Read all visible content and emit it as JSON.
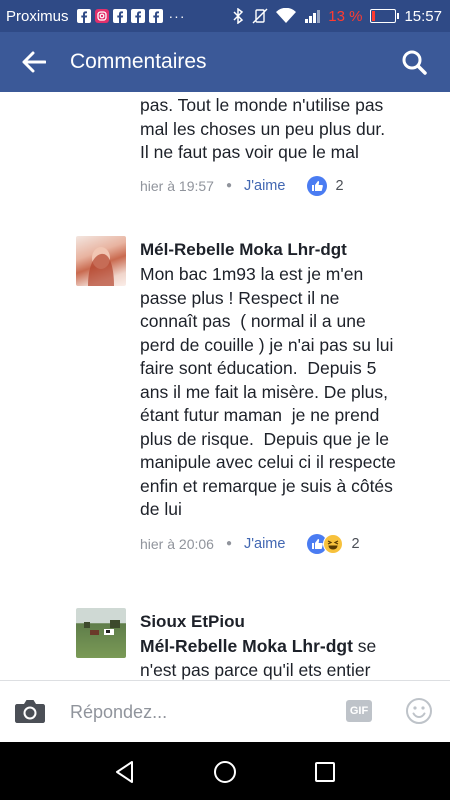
{
  "statusbar": {
    "carrier": "Proximus",
    "battery_percent": "13 %",
    "battery_level": 0.13,
    "time": "15:57",
    "notification_icons": [
      "facebook-icon",
      "instagram-icon",
      "facebook-icon",
      "facebook-icon",
      "facebook-icon"
    ]
  },
  "appbar": {
    "title": "Commentaires",
    "color": "#3b5998"
  },
  "comments": [
    {
      "text_lines": [
        "pas. Tout le monde n'utilise pas",
        "mal les choses un peu plus dur.",
        "Il ne faut pas voir que le mal"
      ],
      "time": "hier à 19:57",
      "like_label": "J'aime",
      "reaction_count": "2",
      "reactions": [
        "like"
      ]
    },
    {
      "author": "Mél-Rebelle Moka Lhr-dgt",
      "text_lines": [
        "Mon bac 1m93 la est je m'en",
        "passe plus ! Respect il ne",
        "connaît pas  ( normal il a une",
        "perd de couille ) je n'ai pas su lui",
        "faire sont éducation.  Depuis 5",
        "ans il me fait la misère. De plus,",
        "étant futur maman  je ne prend",
        "plus de risque.  Depuis que je le",
        "manipule avec celui ci il respecte",
        "enfin et remarque je suis à côtés",
        "de lui"
      ],
      "time": "hier à 20:06",
      "like_label": "J'aime",
      "reaction_count": "2",
      "reactions": [
        "like",
        "haha"
      ]
    },
    {
      "author": "Sioux EtPiou",
      "mention": "Mél-Rebelle Moka Lhr-dgt",
      "text_after_mention": " se",
      "text_lines": [
        "n'est pas parce qu'il ets entier"
      ]
    }
  ],
  "reply": {
    "placeholder": "Répondez...",
    "gif_label": "GIF"
  },
  "colors": {
    "statusbar": "#2f4a86",
    "link": "#4267b2",
    "battery_low": "#ff3b30"
  }
}
